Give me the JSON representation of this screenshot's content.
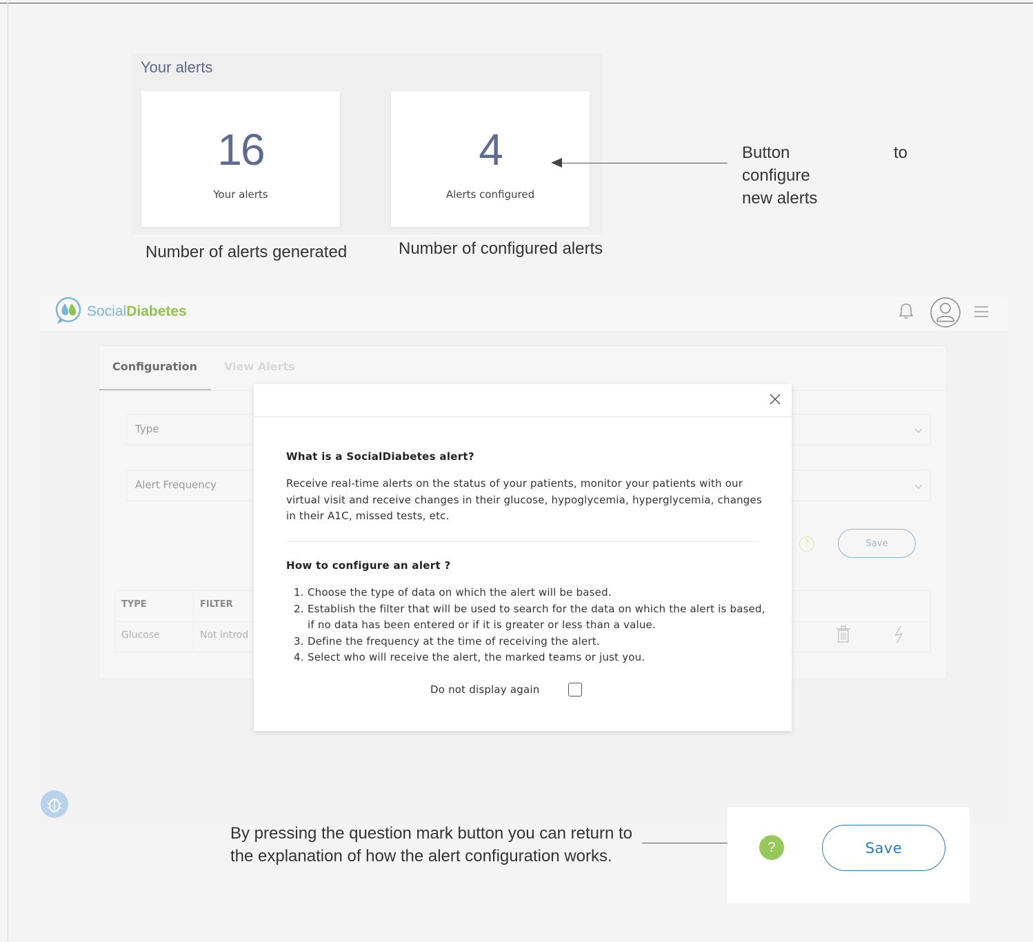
{
  "summary": {
    "title": "Your alerts",
    "cards": [
      {
        "value": "16",
        "label": "Your alerts"
      },
      {
        "value": "4",
        "label": "Alerts configured"
      }
    ]
  },
  "annotations": {
    "generated": "Number of alerts generated",
    "configured": "Number of configured alerts",
    "configure_button_line1": "Button to configure",
    "configure_button_line2": "new alerts",
    "question_line1": "By pressing the question mark button you can return to",
    "question_line2": "the explanation of how the alert configuration works."
  },
  "app": {
    "logo_social": "Social",
    "logo_diabetes": "Diabetes",
    "tabs": [
      {
        "label": "Configuration",
        "active": true
      },
      {
        "label": "View Alerts",
        "active": false
      }
    ],
    "fields": {
      "type_label": "Type",
      "frequency_label": "Alert Frequency"
    },
    "help_symbol": "?",
    "save_label": "Save",
    "table": {
      "headers": [
        "TYPE",
        "FILTER"
      ],
      "rows": [
        {
          "type": "Glucose",
          "filter": "Not introd"
        }
      ]
    }
  },
  "modal": {
    "heading1": "What is a SocialDiabetes alert?",
    "paragraph": "Receive real-time alerts on the status of your patients, monitor your patients with our virtual visit and receive changes in their glucose, hypoglycemia, hyperglycemia, changes in their A1C, missed tests, etc.",
    "heading2": "How to configure an alert ?",
    "steps": [
      "Choose the type of data on which the alert will be based.",
      "Establish the filter that will be used to search for the data on which the alert is based, if no data has been entered or if it is greater or less than a value.",
      "Define the frequency at the time of receiving the alert.",
      "Select who will receive the alert, the marked teams or just you."
    ],
    "step_numbers": [
      "1.",
      "2.",
      "3.",
      "4."
    ],
    "dont_show": "Do not display again",
    "dont_show_checked": false
  },
  "bottom": {
    "help_symbol": "?",
    "save_label": "Save"
  },
  "colors": {
    "brand_blue": "#2a7cc0",
    "brand_green": "#97c95a",
    "stat_number": "#5e6b92"
  }
}
